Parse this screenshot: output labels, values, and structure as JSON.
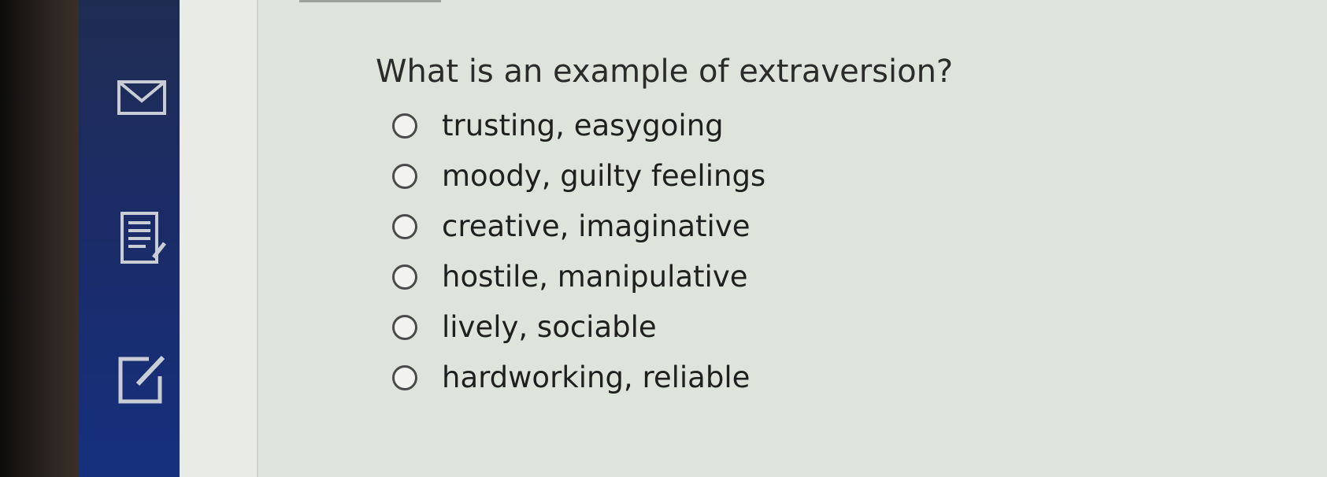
{
  "question": {
    "text": "What is an example of extraversion?"
  },
  "options": [
    {
      "label": "trusting, easygoing"
    },
    {
      "label": "moody, guilty feelings"
    },
    {
      "label": "creative, imaginative"
    },
    {
      "label": "hostile, manipulative"
    },
    {
      "label": "lively, sociable"
    },
    {
      "label": "hardworking, reliable"
    }
  ],
  "sidebar": {
    "icons": [
      "mail-icon",
      "notes-icon",
      "edit-icon"
    ]
  },
  "colors": {
    "sidebar": "#1b2b66",
    "content_bg": "#dee3dc",
    "text": "#2b2b2b"
  }
}
